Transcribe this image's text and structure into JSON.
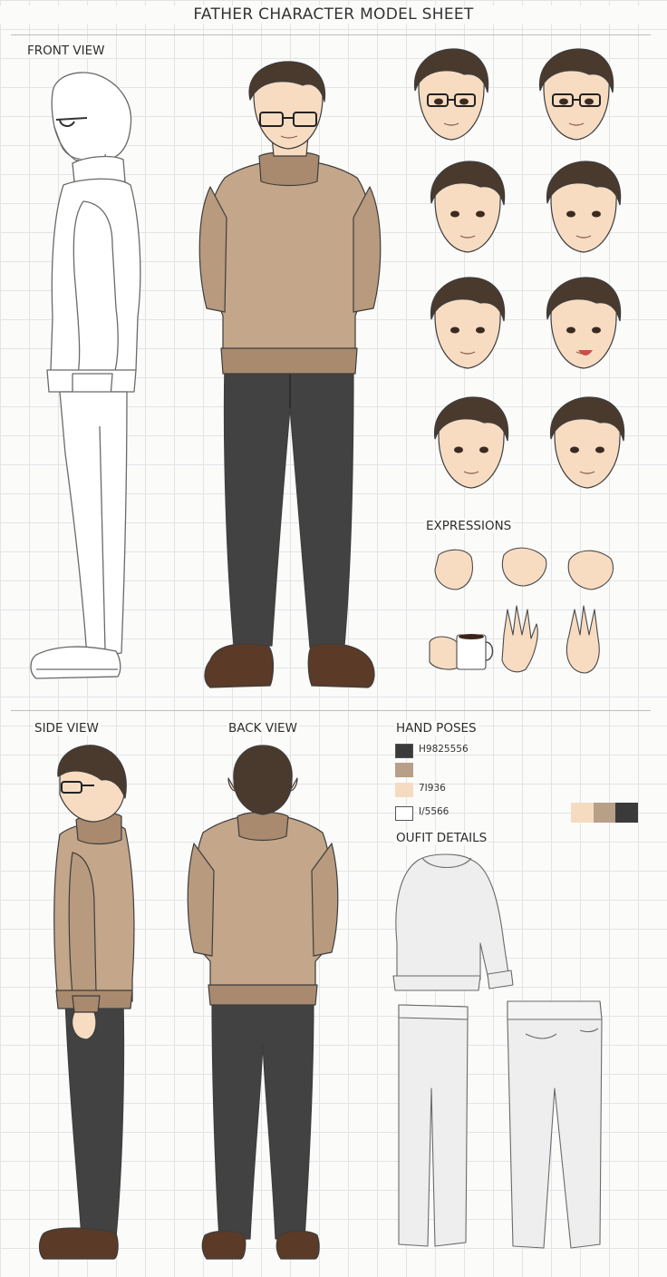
{
  "sheet": {
    "title": "FATHER CHARACTER MODEL SHEET"
  },
  "labels": {
    "front_view": "FRONT VIEW",
    "expressions": "EXPRESSIONS",
    "side_view": "SIDE VIEW",
    "back_view": "BACK VIEW",
    "hand_poses": "HAND POSES",
    "outfit_details": "OUFIT DETAILS"
  },
  "palette": {
    "items": [
      {
        "label": "H9825556",
        "color": "#3a3a3a"
      },
      {
        "label": "",
        "color": "#b89f88"
      },
      {
        "label": "7I936",
        "color": "#f5dcc0"
      },
      {
        "label": "I/5566",
        "color": "#ffffff"
      }
    ],
    "strip": [
      "#f5dcc0",
      "#b89f88",
      "#3a3a3a"
    ]
  },
  "colors": {
    "sweater": "#c4a68a",
    "sweater_shade": "#a98a6e",
    "pants": "#424242",
    "shoes": "#5b3a27",
    "hair": "#4a3a2e",
    "skin": "#f7dcc2",
    "lineart": "#4a4a4a"
  }
}
